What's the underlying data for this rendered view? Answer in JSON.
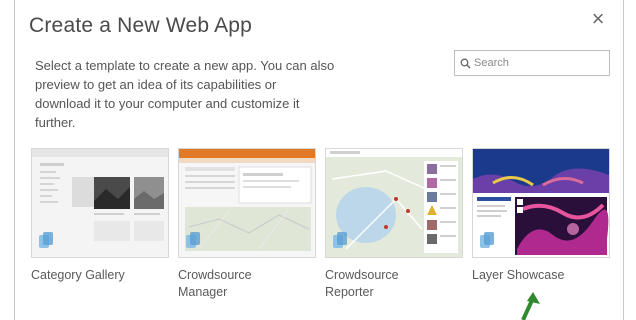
{
  "dialog": {
    "title": "Create a New Web App",
    "close_symbol": "×",
    "description": "Select a template to create a new app. You can also preview to get an idea of its capabilities or download it to your computer and customize it further."
  },
  "search": {
    "placeholder": "Search",
    "value": "",
    "icon": "search-icon"
  },
  "templates": [
    {
      "label": "Category Gallery"
    },
    {
      "label": "Crowdsource Manager"
    },
    {
      "label": "Crowdsource Reporter"
    },
    {
      "label": "Layer Showcase"
    }
  ],
  "colors": {
    "accent_orange": "#e07a26",
    "showcase_blue": "#1b3a8c",
    "arrow_green": "#2f8a2f",
    "badge_blue": "#5a9fd4"
  }
}
